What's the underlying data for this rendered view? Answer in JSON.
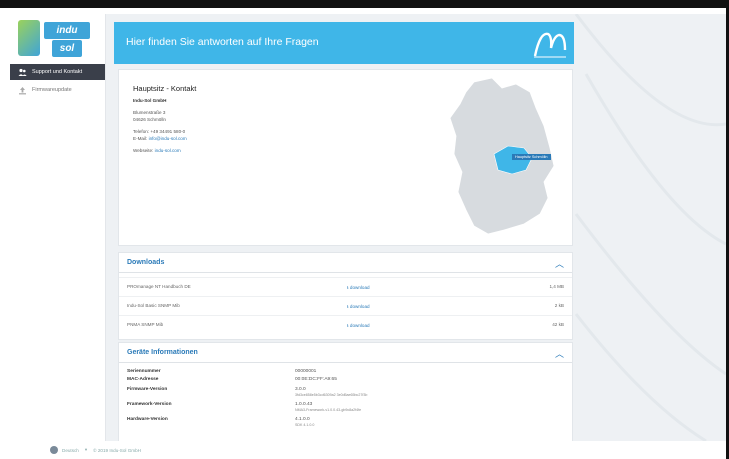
{
  "sidebar": {
    "logo_top": "indu",
    "logo_bottom": "sol",
    "items": [
      {
        "label": "Support und Kontakt",
        "icon": "users-icon",
        "active": true
      },
      {
        "label": "Firmwareupdate",
        "icon": "upload-icon",
        "active": false
      }
    ]
  },
  "banner": {
    "title": "Hier finden Sie antworten auf Ihre Fragen",
    "logo_icon": "brand-wave-icon"
  },
  "contact": {
    "heading": "Hauptsitz - Kontakt",
    "company": "Indu-Sol GmbH",
    "street": "Blumenstraße 3",
    "city": "04626 Schmölln",
    "phone": "Telefon: +49 34491 580-0",
    "email_prefix": "E-Mail:",
    "email": "info@indu-sol.com",
    "website_prefix": "Webseite:",
    "website": "indu-sol.com",
    "map_label": "Hauptsitz Schmölln",
    "map_highlight_color": "#3fb6e8"
  },
  "downloads": {
    "title": "Downloads",
    "rows": [
      {
        "name": "PROmanage NT Handbuch DE",
        "link": "download",
        "size": "1,4 MB"
      },
      {
        "name": "Indu-Sol Basic SNMP Mib",
        "link": "download",
        "size": "2 kB"
      },
      {
        "name": "PNMA SNMP Mib",
        "link": "download",
        "size": "42 kB"
      }
    ]
  },
  "geraete": {
    "title": "Geräte Informationen",
    "rows": [
      {
        "key": "Seriennummer",
        "value": "00000001",
        "sub": ""
      },
      {
        "key": "MAC-Adresse",
        "value": "00:0E:DC:FF:A9:65",
        "sub": ""
      },
      {
        "key": "Firmware-Version",
        "value": "3.0.0",
        "sub": "3fd3ce858e5b3cd6309a2 3e0d5ae65bc27f3b"
      },
      {
        "key": "Framework-Version",
        "value": "1.0.0.43",
        "sub": "NMA3-Framework-v1.0.0.43-gb9c8a2f4fe"
      },
      {
        "key": "Hardware-Version",
        "value": "4.1.0.0",
        "sub": "SDK 4.1.0.0"
      }
    ]
  },
  "footer": {
    "language": "Deutsch",
    "copyright": "© 2019 Indu-Sol GmbH"
  }
}
